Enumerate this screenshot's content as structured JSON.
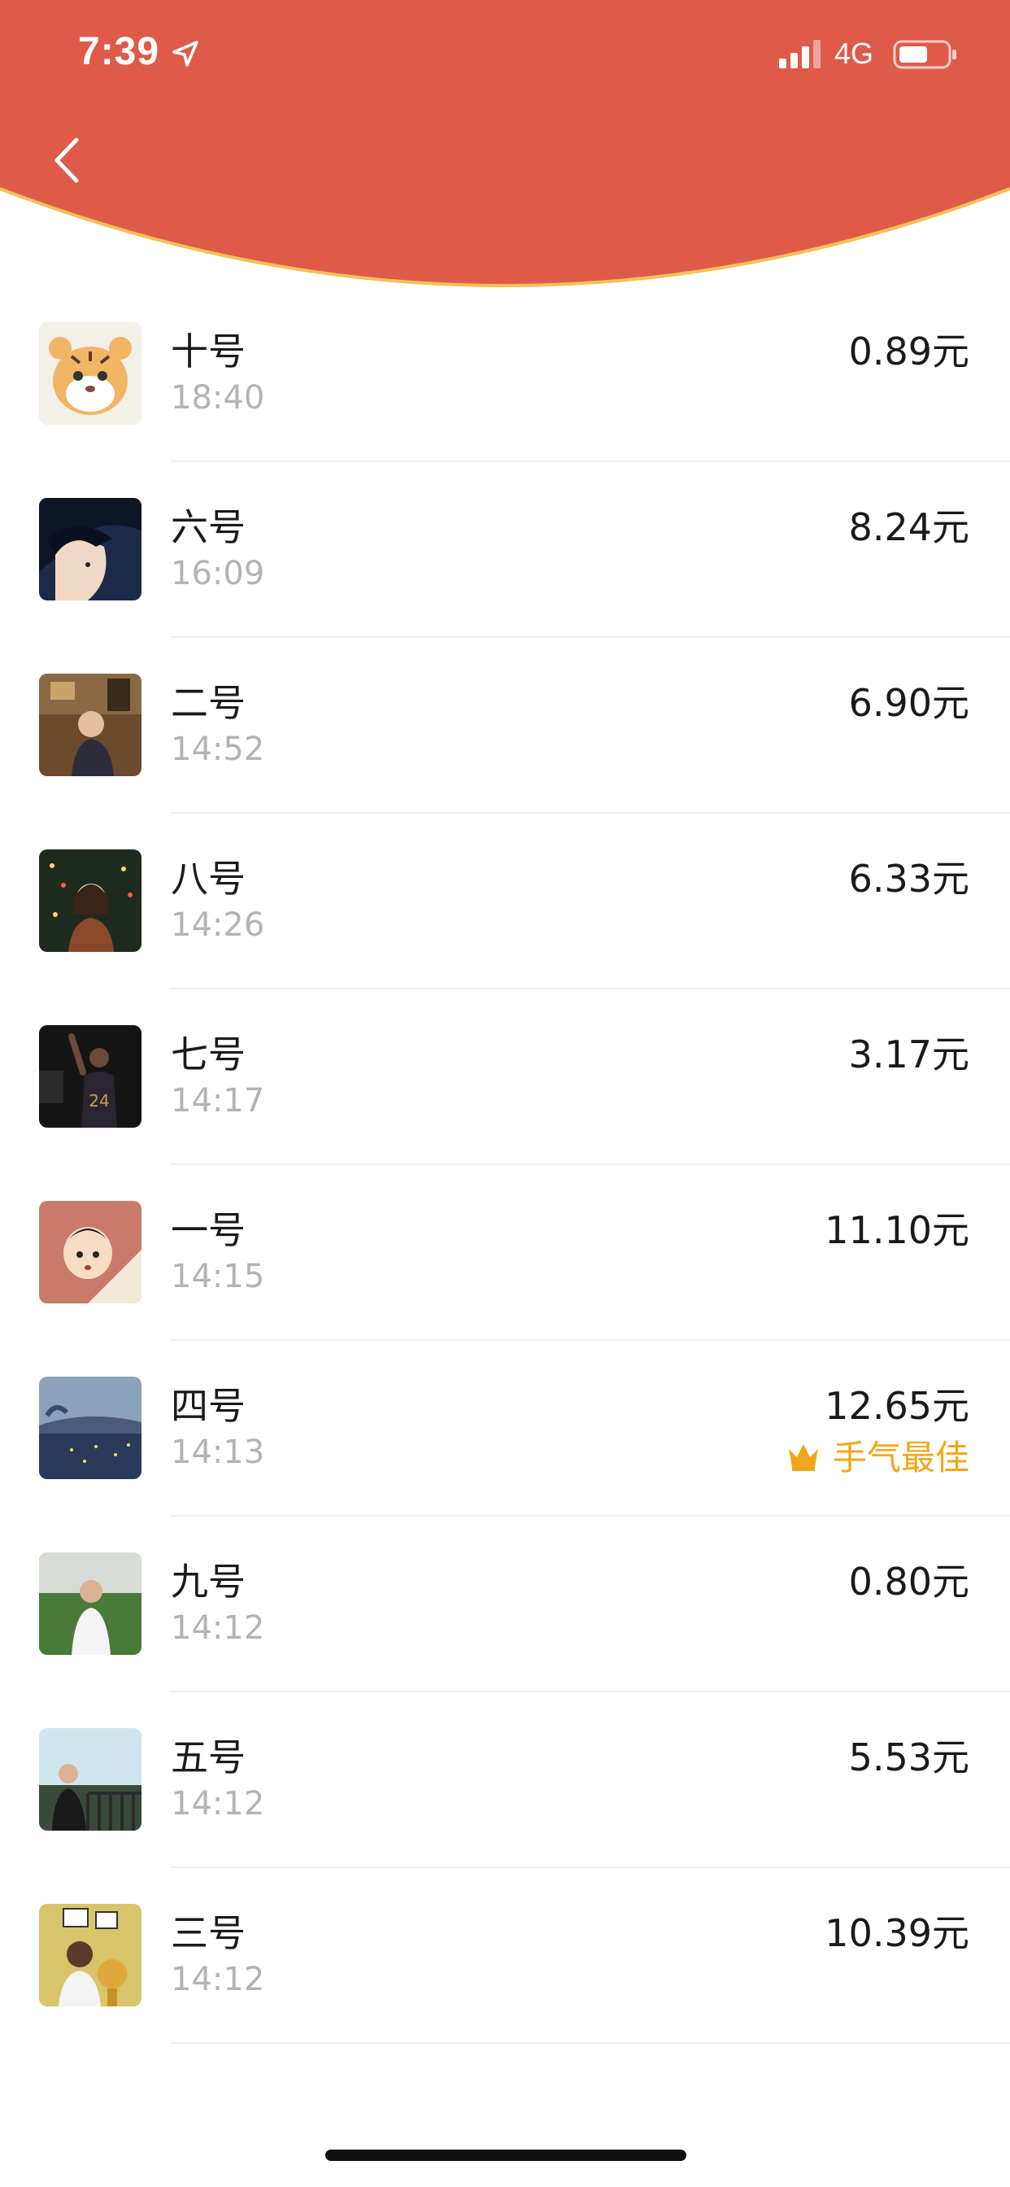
{
  "status_bar": {
    "time": "7:39",
    "network": "4G"
  },
  "colors": {
    "header_red": "#de5b49",
    "header_edge": "#f2c15a",
    "best_gold": "#f0a71a"
  },
  "icons": {
    "back": "chevron-left-icon",
    "location": "location-arrow-icon",
    "signal": "signal-bars-icon",
    "battery": "battery-icon",
    "crown": "crown-icon"
  },
  "records": [
    {
      "name": "十号",
      "time": "18:40",
      "amount": "0.89元"
    },
    {
      "name": "六号",
      "time": "16:09",
      "amount": "8.24元"
    },
    {
      "name": "二号",
      "time": "14:52",
      "amount": "6.90元"
    },
    {
      "name": "八号",
      "time": "14:26",
      "amount": "6.33元"
    },
    {
      "name": "七号",
      "time": "14:17",
      "amount": "3.17元"
    },
    {
      "name": "一号",
      "time": "14:15",
      "amount": "11.10元"
    },
    {
      "name": "四号",
      "time": "14:13",
      "amount": "12.65元",
      "badge": "手气最佳"
    },
    {
      "name": "九号",
      "time": "14:12",
      "amount": "0.80元"
    },
    {
      "name": "五号",
      "time": "14:12",
      "amount": "5.53元"
    },
    {
      "name": "三号",
      "time": "14:12",
      "amount": "10.39元"
    }
  ]
}
